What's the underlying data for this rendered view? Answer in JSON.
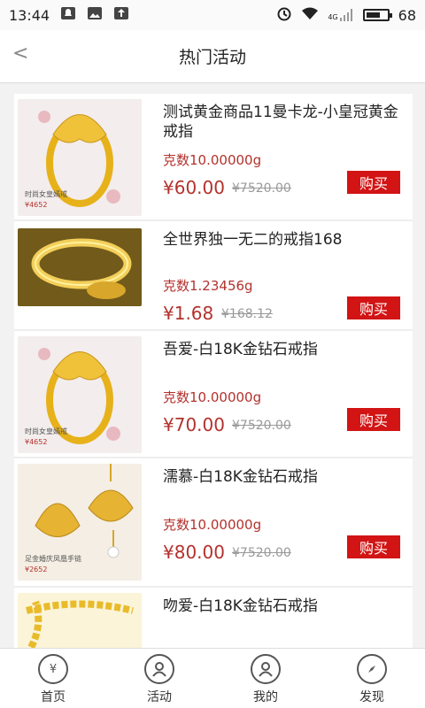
{
  "status_bar": {
    "time": "13:44",
    "network": "4G",
    "battery": "68",
    "battery_level": 0.68
  },
  "header": {
    "back_icon": "back-chevron-icon",
    "back_label": "<",
    "title": "热门活动"
  },
  "products": [
    {
      "name": "测试黄金商品11曼卡龙-小皇冠黄金戒指",
      "weight": "克数10.00000g",
      "price": "¥60.00",
      "original_price": "¥7520.00",
      "buy_label": "购买",
      "image": "ring-crown",
      "image_caption": "时尚女皇嫣戒",
      "image_price": "¥4652"
    },
    {
      "name": "全世界独一无二的戒指168",
      "weight": "克数1.23456g",
      "price": "¥1.68",
      "original_price": "¥168.12",
      "buy_label": "购买",
      "image": "gold-bangle",
      "image_caption": "",
      "image_price": ""
    },
    {
      "name": "吾爱-白18K金钻石戒指",
      "weight": "克数10.00000g",
      "price": "¥70.00",
      "original_price": "¥7520.00",
      "buy_label": "购买",
      "image": "ring-crown",
      "image_caption": "时尚女皇嫣戒",
      "image_price": "¥4652"
    },
    {
      "name": "濡慕-白18K金钻石戒指",
      "weight": "克数10.00000g",
      "price": "¥80.00",
      "original_price": "¥7520.00",
      "buy_label": "购买",
      "image": "shell-pendant",
      "image_caption": "足金婚庆凤凰手链",
      "image_price": "¥2652"
    },
    {
      "name": "吻爱-白18K金钻石戒指",
      "weight": "",
      "price": "",
      "original_price": "",
      "buy_label": "",
      "image": "gold-chain",
      "image_caption": "",
      "image_price": ""
    }
  ],
  "tabbar": {
    "items": [
      {
        "label": "首页",
        "icon": "home-yen-icon"
      },
      {
        "label": "活动",
        "icon": "activity-user-icon"
      },
      {
        "label": "我的",
        "icon": "profile-user-icon"
      },
      {
        "label": "发现",
        "icon": "compass-icon"
      }
    ]
  },
  "colors": {
    "accent": "#d21414",
    "price": "#b3322d",
    "background": "#f2f2f2"
  }
}
